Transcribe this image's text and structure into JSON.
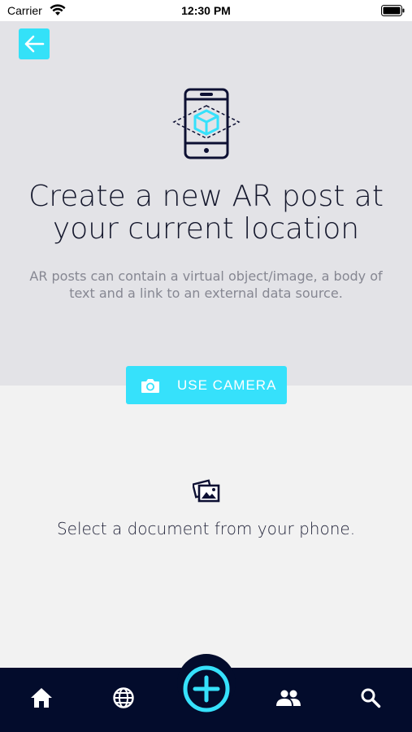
{
  "status_bar": {
    "carrier": "Carrier",
    "time": "12:30 PM"
  },
  "header": {
    "back_icon": "arrow-left-icon",
    "hero_icon": "ar-phone-cube-icon",
    "title": "Create a new AR post at your current location",
    "subtitle": "AR posts can contain a virtual object/image, a body of text and a link to an external data source."
  },
  "camera_button": {
    "icon": "camera-icon",
    "label": "USE CAMERA"
  },
  "document": {
    "icon": "photos-icon",
    "text": "Select a document from your phone."
  },
  "tab_bar": {
    "items": [
      {
        "id": "home",
        "icon": "home-icon"
      },
      {
        "id": "globe",
        "icon": "globe-icon"
      },
      {
        "id": "add",
        "icon": "plus-circle-icon"
      },
      {
        "id": "people",
        "icon": "people-icon"
      },
      {
        "id": "search",
        "icon": "search-icon"
      }
    ]
  },
  "colors": {
    "accent": "#36e1fb",
    "tab_bar": "#030c2c",
    "top_panel": "#e3e3e7",
    "background": "#f2f2f2",
    "text_dark": "#14172c",
    "text_muted": "#868792"
  }
}
